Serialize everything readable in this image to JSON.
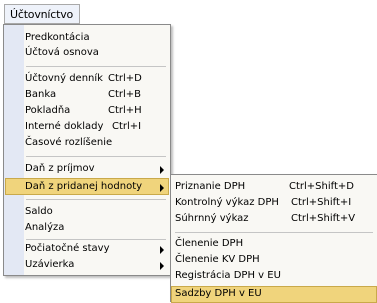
{
  "menubar": {
    "label": "Účtovníctvo"
  },
  "menu": {
    "items": [
      {
        "label": "Predkontácia",
        "shortcut": ""
      },
      {
        "label": "Účtová osnova",
        "shortcut": ""
      },
      {
        "label": "Účtovný denník",
        "shortcut": "Ctrl+D"
      },
      {
        "label": "Banka",
        "shortcut": "Ctrl+B"
      },
      {
        "label": "Pokladňa",
        "shortcut": "Ctrl+H"
      },
      {
        "label": "Interné doklady",
        "shortcut": "Ctrl+I"
      },
      {
        "label": "Časové rozlíšenie",
        "shortcut": ""
      },
      {
        "label": "Daň z príjmov",
        "shortcut": ""
      },
      {
        "label": "Daň z pridanej hodnoty",
        "shortcut": ""
      },
      {
        "label": "Saldo",
        "shortcut": ""
      },
      {
        "label": "Analýza",
        "shortcut": ""
      },
      {
        "label": "Počiatočné stavy",
        "shortcut": ""
      },
      {
        "label": "Uzávierka",
        "shortcut": ""
      }
    ]
  },
  "submenu": {
    "items": [
      {
        "label": "Priznanie DPH",
        "shortcut": "Ctrl+Shift+D"
      },
      {
        "label": "Kontrolný výkaz DPH",
        "shortcut": "Ctrl+Shift+I"
      },
      {
        "label": "Súhrnný výkaz",
        "shortcut": "Ctrl+Shift+V"
      },
      {
        "label": "Členenie DPH",
        "shortcut": ""
      },
      {
        "label": "Členenie KV DPH",
        "shortcut": ""
      },
      {
        "label": "Registrácia DPH v EU",
        "shortcut": ""
      },
      {
        "label": "Sadzby DPH v EU",
        "shortcut": ""
      }
    ]
  },
  "colors": {
    "highlight": "#f0d47c",
    "menu_bg": "#f9f8f4",
    "gutter": "#e3e8f4"
  }
}
